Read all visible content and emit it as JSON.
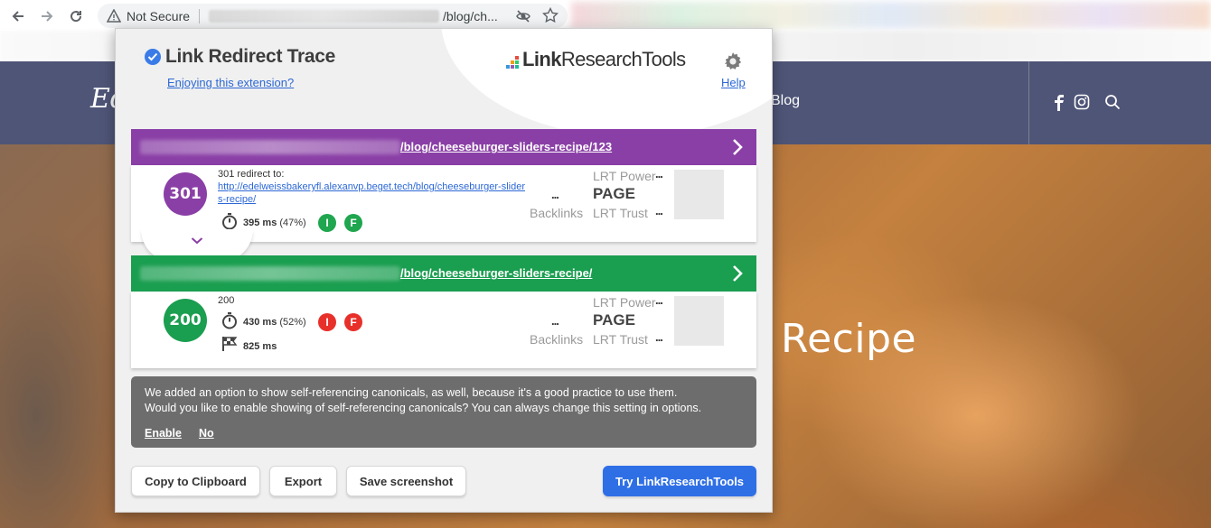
{
  "browser": {
    "security_label": "Not Secure",
    "url_path": "/blog/ch..."
  },
  "site": {
    "logo": "Ed",
    "nav_blog": "Blog",
    "hero_title": "Recipe"
  },
  "popup": {
    "title": "Link Redirect Trace",
    "enjoy_link": "Enjoying this extension?",
    "brand_bold": "Link",
    "brand_rest": "ResearchTools",
    "help_link": "Help",
    "hops": [
      {
        "url": "/blog/cheeseburger-sliders-recipe/123",
        "status": "301",
        "redirect_label": "301 redirect to:",
        "redirect_url": "http://edelweissbakeryfl.alexanvp.beget.tech/blog/cheeseburger-sliders-recipe/",
        "time": "395 ms",
        "time_pct": "(47%)",
        "badge_i": "I",
        "badge_f": "F",
        "dots": "...",
        "backlinks": "Backlinks",
        "lrt_power": "LRT Power",
        "page": "PAGE",
        "lrt_trust": "LRT Trust",
        "power_dots": "...",
        "trust_dots": "..."
      },
      {
        "url": "/blog/cheeseburger-sliders-recipe/",
        "status": "200",
        "redirect_label": "200",
        "time": "430 ms",
        "time_pct": "(52%)",
        "total_time": "825 ms",
        "badge_i": "I",
        "badge_f": "F",
        "dots": "...",
        "backlinks": "Backlinks",
        "lrt_power": "LRT Power",
        "page": "PAGE",
        "lrt_trust": "LRT Trust",
        "power_dots": "...",
        "trust_dots": "..."
      }
    ],
    "notice": {
      "line1": "We added an option to show self-referencing canonicals, as well, because it's a good practice to use them.",
      "line2": "Would you like to enable showing of self-referencing canonicals? You can always change this setting in options.",
      "enable": "Enable",
      "no": "No"
    },
    "buttons": {
      "copy": "Copy to Clipboard",
      "export": "Export",
      "screenshot": "Save screenshot",
      "try": "Try LinkResearchTools"
    }
  },
  "colors": {
    "purple": "#8a3fa6",
    "green": "#1a9e50",
    "link": "#2c68d6",
    "primary_button": "#2f6fe6"
  }
}
